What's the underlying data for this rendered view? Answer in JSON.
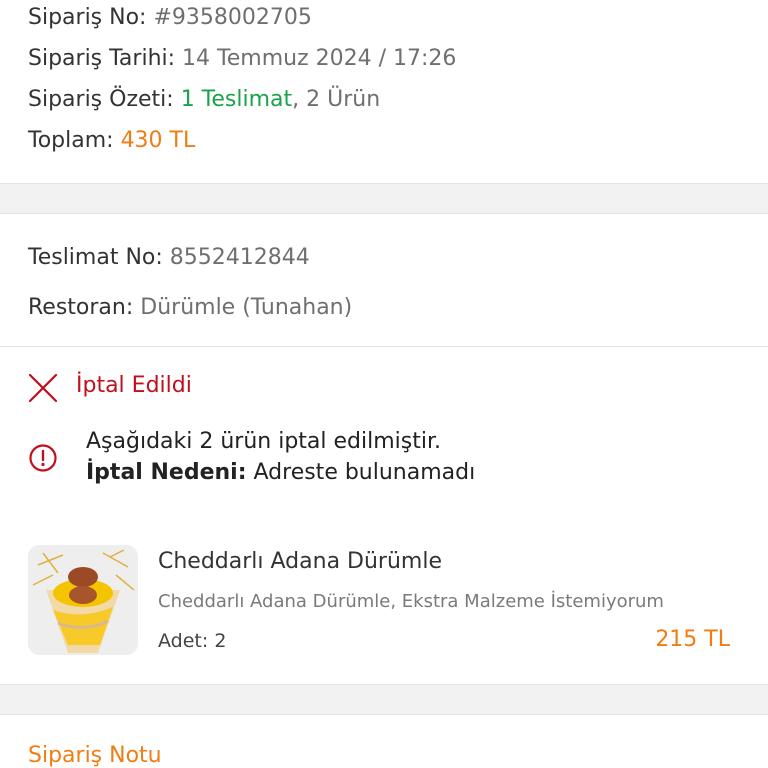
{
  "order": {
    "no_label": "Sipariş No:",
    "no_value": "#9358002705",
    "date_label": "Sipariş Tarihi:",
    "date_value": "14 Temmuz 2024 / 17:26",
    "summary_label": "Sipariş Özeti:",
    "summary_delivery": "1 Teslimat",
    "summary_items": ", 2 Ürün",
    "total_label": "Toplam:",
    "total_value": "430 TL"
  },
  "delivery": {
    "no_label": "Teslimat No:",
    "no_value": "8552412844",
    "restaurant_label": "Restoran:",
    "restaurant_value": "Dürümle (Tunahan)"
  },
  "status": {
    "icon": "close-icon",
    "text": "İptal Edildi",
    "color": "#c0101e"
  },
  "cancel_info": {
    "icon": "info-icon",
    "line1": "Aşağıdaki 2 ürün iptal edilmiştir.",
    "reason_label": "İptal Nedeni:",
    "reason_value": "Adreste bulunamadı"
  },
  "product": {
    "name": "Cheddarlı Adana Dürümle",
    "description": "Cheddarlı Adana Dürümle, Ekstra Malzeme İstemiyorum",
    "qty_label": "Adet:",
    "qty_value": "2",
    "price": "215 TL"
  },
  "notes": {
    "title": "Sipariş Notu"
  },
  "colors": {
    "accent": "#f07d14",
    "success": "#1aa34a",
    "danger": "#c0101e"
  }
}
